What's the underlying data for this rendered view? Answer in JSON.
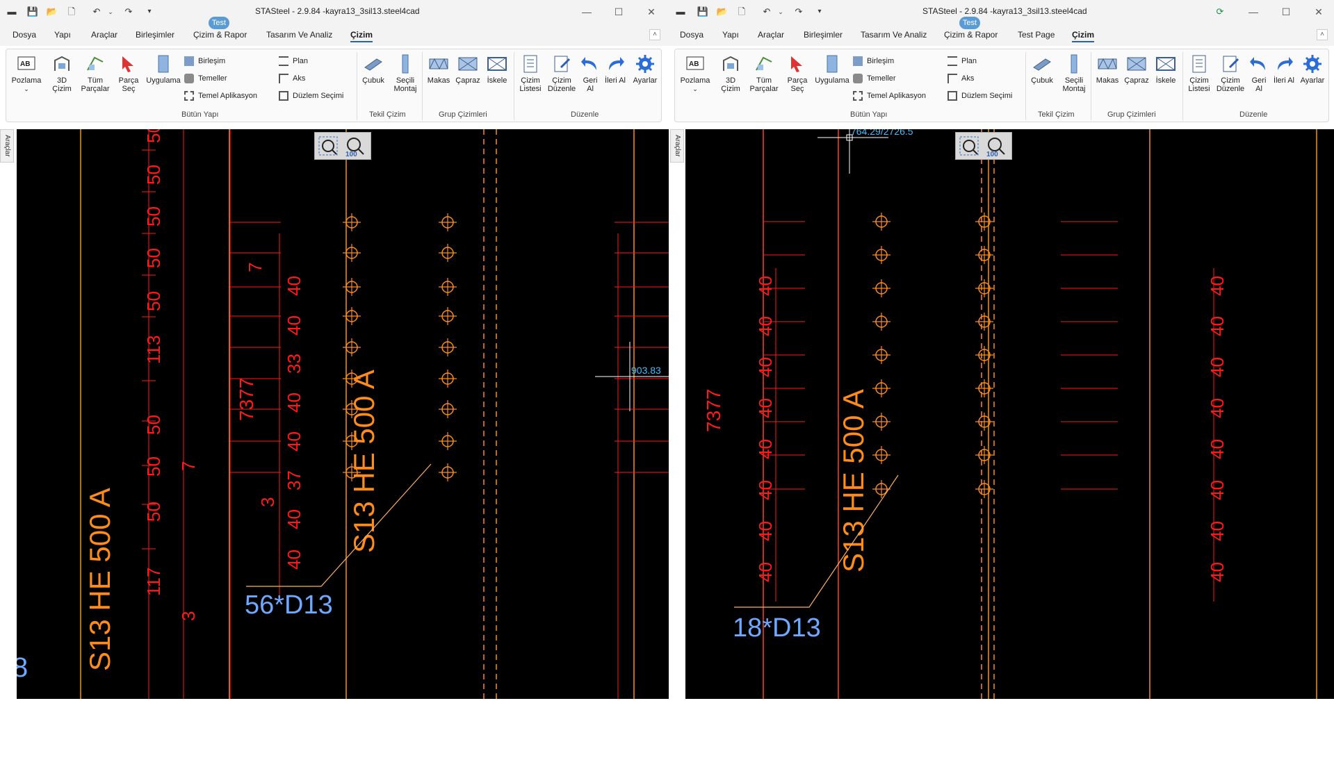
{
  "app": {
    "title": "STASteel - 2.9.84 -kayra13_3sil13.steel4cad"
  },
  "left": {
    "menu": [
      "Dosya",
      "Yapı",
      "Araçlar",
      "Birleşimler",
      "Çizim & Rapor",
      "Tasarım Ve Analiz",
      "Çizim"
    ],
    "active_menu": "Çizim",
    "badge": "Test",
    "side_tab": "Araçlar",
    "canvas": {
      "dim_left": [
        "50",
        "50",
        "50",
        "50",
        "50",
        "113",
        "50",
        "50",
        "50",
        "117"
      ],
      "dim_mid": [
        "40",
        "40",
        "33",
        "40",
        "40",
        "37",
        "40",
        "40"
      ],
      "dim_extra": [
        "7",
        "7",
        "3",
        "3"
      ],
      "long_dim": "7377",
      "section_left": "S13  HE 500 A",
      "section_mid": "S13  HE 500 A",
      "callout": "56*D13",
      "coord": "903.83",
      "zoom_label": "100"
    }
  },
  "right": {
    "menu": [
      "Dosya",
      "Yapı",
      "Araçlar",
      "Birleşimler",
      "Tasarım Ve Analiz",
      "Çizim & Rapor",
      "Test Page",
      "Çizim"
    ],
    "active_menu": "Çizim",
    "badge": "Test",
    "side_tab": "Araçlar",
    "canvas": {
      "dim_left": [
        "40",
        "40",
        "40",
        "40",
        "40",
        "40",
        "40",
        "40"
      ],
      "dim_right": [
        "40",
        "40",
        "40",
        "40",
        "40",
        "40",
        "40",
        "40"
      ],
      "long_dim": "7377",
      "section": "S13  HE 500 A",
      "callout": "18*D13",
      "coord": "764.29/2726.5",
      "zoom_label": "100"
    }
  },
  "ribbon": {
    "pozlama": "Pozlama",
    "cizim3d": "3D Çizim",
    "tum_parcalar": "Tüm Parçalar",
    "parca_sec": "Parça Seç",
    "uygulama": "Uygulama",
    "birlesim": "Birleşim",
    "temeller": "Temeller",
    "temel_aplikasyon": "Temel Aplikasyon",
    "plan": "Plan",
    "aks": "Aks",
    "duzlem_secimi": "Düzlem Seçimi",
    "group_butun": "Bütün Yapı",
    "cubuk": "Çubuk",
    "secili_montaj": "Seçili Montaj",
    "group_tekil": "Tekil Çizim",
    "makas": "Makas",
    "capraz": "Çapraz",
    "iskele": "İskele",
    "group_grup": "Grup Çizimleri",
    "cizim_listesi": "Çizim Listesi",
    "cizim_duzenle": "Çizim Düzenle",
    "geri_al": "Geri Al",
    "ileri_al": "İleri Al",
    "ayarlar": "Ayarlar",
    "group_duzenle": "Düzenle"
  },
  "colors": {
    "accent": "#2b5fb3",
    "cad_red": "#ff1a1a",
    "cad_orange": "#ff8c1a",
    "cad_blue": "#6fa8ff",
    "cad_cyan": "#40c0ff"
  }
}
